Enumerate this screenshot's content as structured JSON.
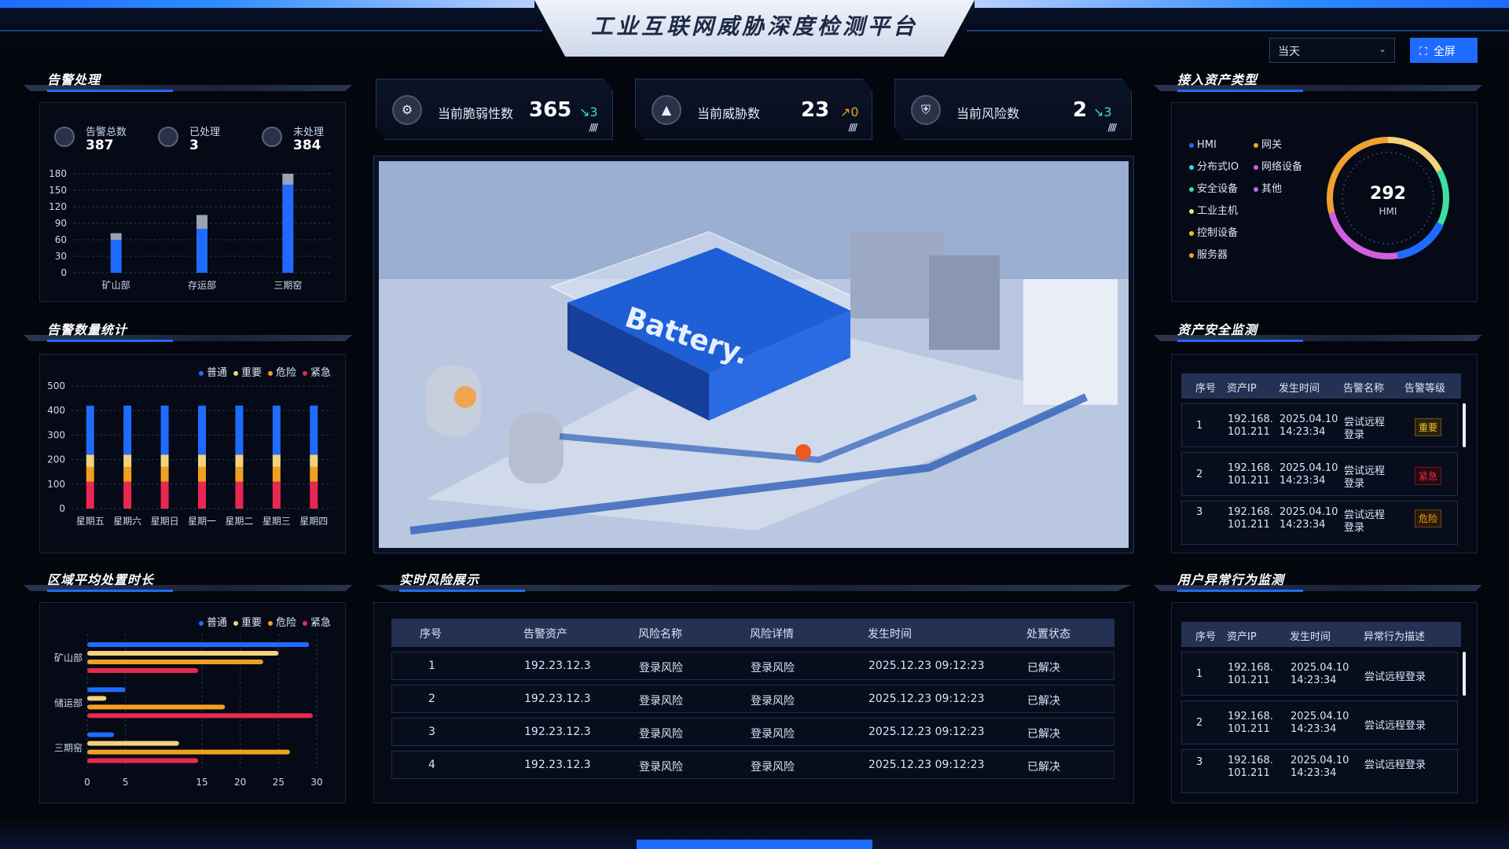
{
  "header": {
    "title": "工业互联网威胁深度检测平台",
    "date_select": "当天",
    "fullscreen": "全屏"
  },
  "stats": [
    {
      "icon": "shield-vuln-icon",
      "label": "当前脆弱性数",
      "value": "365",
      "delta": "3",
      "delta_dir": "down",
      "color": "#3be0b8"
    },
    {
      "icon": "warning-icon",
      "label": "当前威胁数",
      "value": "23",
      "delta": "0",
      "delta_dir": "up",
      "color": "#f0a030"
    },
    {
      "icon": "shield-risk-icon",
      "label": "当前风险数",
      "value": "2",
      "delta": "3",
      "delta_dir": "down",
      "color": "#3be0b8"
    }
  ],
  "alarm": {
    "heading": "告警处理",
    "total_label": "告警总数",
    "total": "387",
    "done_label": "已处理",
    "done": "3",
    "pending_label": "未处理",
    "pending": "384",
    "chart_data": {
      "type": "bar",
      "categories": [
        "矿山部",
        "存运部",
        "三期窑"
      ],
      "series": [
        {
          "values": [
            60,
            80,
            160
          ],
          "color": "#1f6bff"
        },
        {
          "values": [
            12,
            25,
            20
          ],
          "color": "#9aa3b5"
        }
      ],
      "ylim": [
        0,
        180
      ],
      "yticks": [
        "180",
        "150",
        "120",
        "90",
        "60",
        "30",
        "0"
      ]
    }
  },
  "alarm_count": {
    "heading": "告警数量统计",
    "legend": [
      "普通",
      "重要",
      "危险",
      "紧急"
    ],
    "colors": [
      "#1f6bff",
      "#f3d27a",
      "#f0a020",
      "#e8294f"
    ],
    "chart_data": {
      "type": "bar",
      "stacked": true,
      "categories": [
        "星期五",
        "星期六",
        "星期日",
        "星期一",
        "星期二",
        "星期三",
        "星期四"
      ],
      "series": [
        {
          "name": "紧急",
          "values": [
            110,
            110,
            110,
            110,
            110,
            110,
            110
          ]
        },
        {
          "name": "危险",
          "values": [
            60,
            60,
            60,
            60,
            60,
            60,
            60
          ]
        },
        {
          "name": "重要",
          "values": [
            50,
            50,
            50,
            50,
            50,
            50,
            50
          ]
        },
        {
          "name": "普通",
          "values": [
            200,
            200,
            200,
            200,
            200,
            200,
            200
          ]
        }
      ],
      "ylim": [
        0,
        500
      ],
      "yticks": [
        "500",
        "400",
        "300",
        "200",
        "100",
        "0"
      ]
    }
  },
  "region_time": {
    "heading": "区域平均处置时长",
    "legend": [
      "普通",
      "重要",
      "危险",
      "紧急"
    ],
    "colors": [
      "#1f6bff",
      "#f3d27a",
      "#f0a020",
      "#e8294f"
    ],
    "chart_data": {
      "type": "bar",
      "orientation": "horizontal",
      "categories": [
        "矿山部",
        "储运部",
        "三期窑"
      ],
      "series": [
        {
          "name": "普通",
          "values": [
            29,
            5,
            3.5
          ]
        },
        {
          "name": "重要",
          "values": [
            25,
            2.5,
            12
          ]
        },
        {
          "name": "危险",
          "values": [
            23,
            18,
            26.5
          ]
        },
        {
          "name": "紧急",
          "values": [
            14.5,
            29.5,
            14.5
          ]
        }
      ],
      "xlim": [
        0,
        30
      ],
      "xticks": [
        "0",
        "5",
        "15",
        "20",
        "25",
        "30"
      ]
    }
  },
  "asset_types": {
    "heading": "接入资产类型",
    "legend_col1": [
      {
        "label": "HMI",
        "color": "#1f6bff"
      },
      {
        "label": "分布式IO",
        "color": "#3bd0e8"
      },
      {
        "label": "安全设备",
        "color": "#3be0a0"
      },
      {
        "label": "工业主机",
        "color": "#f3e27a"
      },
      {
        "label": "控制设备",
        "color": "#f0c030"
      },
      {
        "label": "服务器",
        "color": "#f0a030"
      }
    ],
    "legend_col2": [
      {
        "label": "网关",
        "color": "#f0a030"
      },
      {
        "label": "网络设备",
        "color": "#d060e0"
      },
      {
        "label": "其他",
        "color": "#b070f0"
      }
    ],
    "gauge_value": "292",
    "gauge_label": "HMI"
  },
  "asset_security": {
    "heading": "资产安全监测",
    "columns": [
      "序号",
      "资产IP",
      "发生时间",
      "告警名称",
      "告警等级"
    ],
    "rows": [
      {
        "no": "1",
        "ip1": "192.168.",
        "ip2": "101.211",
        "t1": "2025.04.10",
        "t2": "14:23:34",
        "n1": "尝试远程",
        "n2": "登录",
        "level": "重要",
        "level_color": "#f0c030"
      },
      {
        "no": "2",
        "ip1": "192.168.",
        "ip2": "101.211",
        "t1": "2025.04.10",
        "t2": "14:23:34",
        "n1": "尝试远程",
        "n2": "登录",
        "level": "紧急",
        "level_color": "#e8294f"
      },
      {
        "no": "3",
        "ip1": "192.168.",
        "ip2": "101.211",
        "t1": "2025.04.10",
        "t2": "14:23:34",
        "n1": "尝试远程",
        "n2": "登录",
        "level": "危险",
        "level_color": "#f0a020"
      }
    ]
  },
  "realtime": {
    "heading": "实时风险展示",
    "columns": [
      "序号",
      "告警资产",
      "风险名称",
      "风险详情",
      "发生时间",
      "处置状态"
    ],
    "rows": [
      {
        "no": "1",
        "asset": "192.23.12.3",
        "name": "登录风险",
        "detail": "登录风险",
        "time": "2025.12.23 09:12:23",
        "status": "已解决"
      },
      {
        "no": "2",
        "asset": "192.23.12.3",
        "name": "登录风险",
        "detail": "登录风险",
        "time": "2025.12.23 09:12:23",
        "status": "已解决"
      },
      {
        "no": "3",
        "asset": "192.23.12.3",
        "name": "登录风险",
        "detail": "登录风险",
        "time": "2025.12.23 09:12:23",
        "status": "已解决"
      },
      {
        "no": "4",
        "asset": "192.23.12.3",
        "name": "登录风险",
        "detail": "登录风险",
        "time": "2025.12.23 09:12:23",
        "status": "已解决"
      }
    ]
  },
  "user_behavior": {
    "heading": "用户异常行为监测",
    "columns": [
      "序号",
      "资产IP",
      "发生时间",
      "异常行为描述"
    ],
    "rows": [
      {
        "no": "1",
        "ip1": "192.168.",
        "ip2": "101.211",
        "t1": "2025.04.10",
        "t2": "14:23:34",
        "desc": "尝试远程登录"
      },
      {
        "no": "2",
        "ip1": "192.168.",
        "ip2": "101.211",
        "t1": "2025.04.10",
        "t2": "14:23:34",
        "desc": "尝试远程登录"
      },
      {
        "no": "3",
        "ip1": "192.168.",
        "ip2": "101.211",
        "t1": "2025.04.10",
        "t2": "14:23:34",
        "desc": "尝试远程登录"
      }
    ]
  },
  "scene_text": "Battery."
}
